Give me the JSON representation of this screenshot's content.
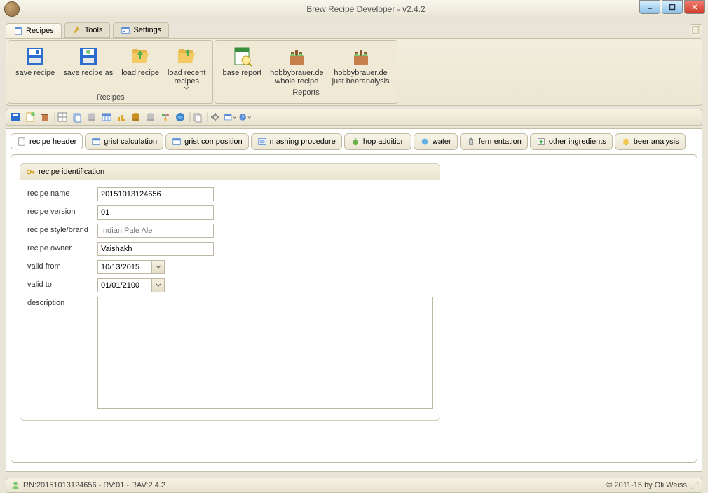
{
  "window": {
    "title": "Brew Recipe Developer - v2.4.2"
  },
  "ribbon_tabs": [
    {
      "label": "Recipes",
      "active": true
    },
    {
      "label": "Tools",
      "active": false
    },
    {
      "label": "Settings",
      "active": false
    }
  ],
  "ribbon": {
    "group_recipes": {
      "label": "Recipes",
      "items": {
        "save": "save recipe",
        "save_as": "save recipe as",
        "load": "load recipe",
        "load_recent": "load recent\nrecipes"
      }
    },
    "group_reports": {
      "label": "Reports",
      "items": {
        "base": "base report",
        "hobbywhole": "hobbybrauer.de\nwhole recipe",
        "hobbybeer": "hobbybrauer.de\njust beeranalysis"
      }
    }
  },
  "subtabs": {
    "recipe_header": "recipe header",
    "grist_calculation": "grist calculation",
    "grist_composition": "grist composition",
    "mashing_procedure": "mashing procedure",
    "hop_addition": "hop addition",
    "water": "water",
    "fermentation": "fermentation",
    "other_ingredients": "other ingredients",
    "beer_analysis": "beer analysis"
  },
  "panel": {
    "title": "recipe identification",
    "labels": {
      "name": "recipe name",
      "version": "recipe version",
      "style": "recipe style/brand",
      "owner": "recipe owner",
      "valid_from": "valid from",
      "valid_to": "valid to",
      "description": "description"
    },
    "values": {
      "name": "20151013124656",
      "version": "01",
      "style_placeholder": "Indian Pale Ale",
      "owner": "Vaishakh",
      "valid_from": "10/13/2015",
      "valid_to": "01/01/2100",
      "description": ""
    }
  },
  "statusbar": {
    "left": "RN:20151013124656 - RV:01 - RAV:2.4.2",
    "right": "© 2011-15 by Oli Weiss"
  }
}
